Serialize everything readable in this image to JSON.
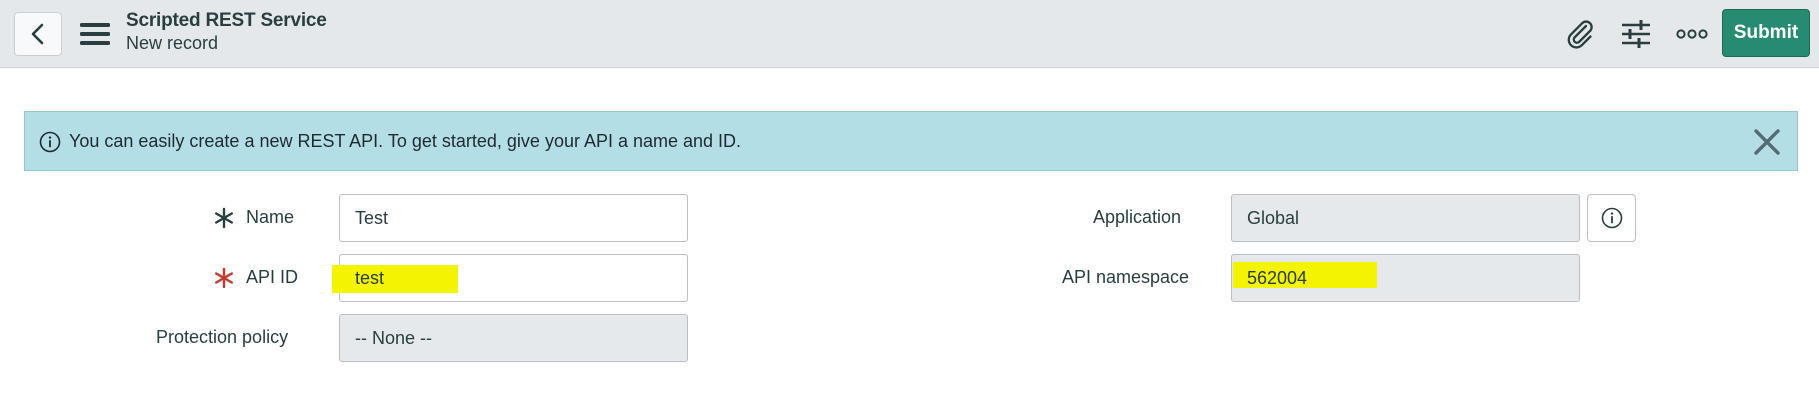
{
  "header": {
    "title": "Scripted REST Service",
    "subtitle": "New record",
    "back_icon": "chevron-left-icon",
    "menu_icon": "hamburger-menu-icon",
    "attachment_icon": "paperclip-icon",
    "personalize_icon": "sliders-icon",
    "more_icon": "more-options-icon",
    "submit_label": "Submit",
    "submit_color": "#278b71"
  },
  "banner": {
    "text": "You can easily create a new REST API. To get started, give your API a name and ID.",
    "info_icon": "info-circle-icon",
    "close_icon": "close-icon",
    "background": "#b4dee5"
  },
  "form": {
    "name": {
      "label": "Name",
      "value": "Test",
      "required": true,
      "required_color": "#293e40"
    },
    "api_id": {
      "label": "API ID",
      "value": "test",
      "required": true,
      "required_color": "#c8372d",
      "highlighted": true
    },
    "protection_policy": {
      "label": "Protection policy",
      "value": "-- None --",
      "readonly": true
    },
    "application": {
      "label": "Application",
      "value": "Global",
      "readonly": true,
      "info_icon": "info-circle-icon"
    },
    "api_namespace": {
      "label": "API namespace",
      "value": "562004",
      "readonly": true,
      "highlighted": true
    }
  },
  "highlight_color": "#f4f400"
}
